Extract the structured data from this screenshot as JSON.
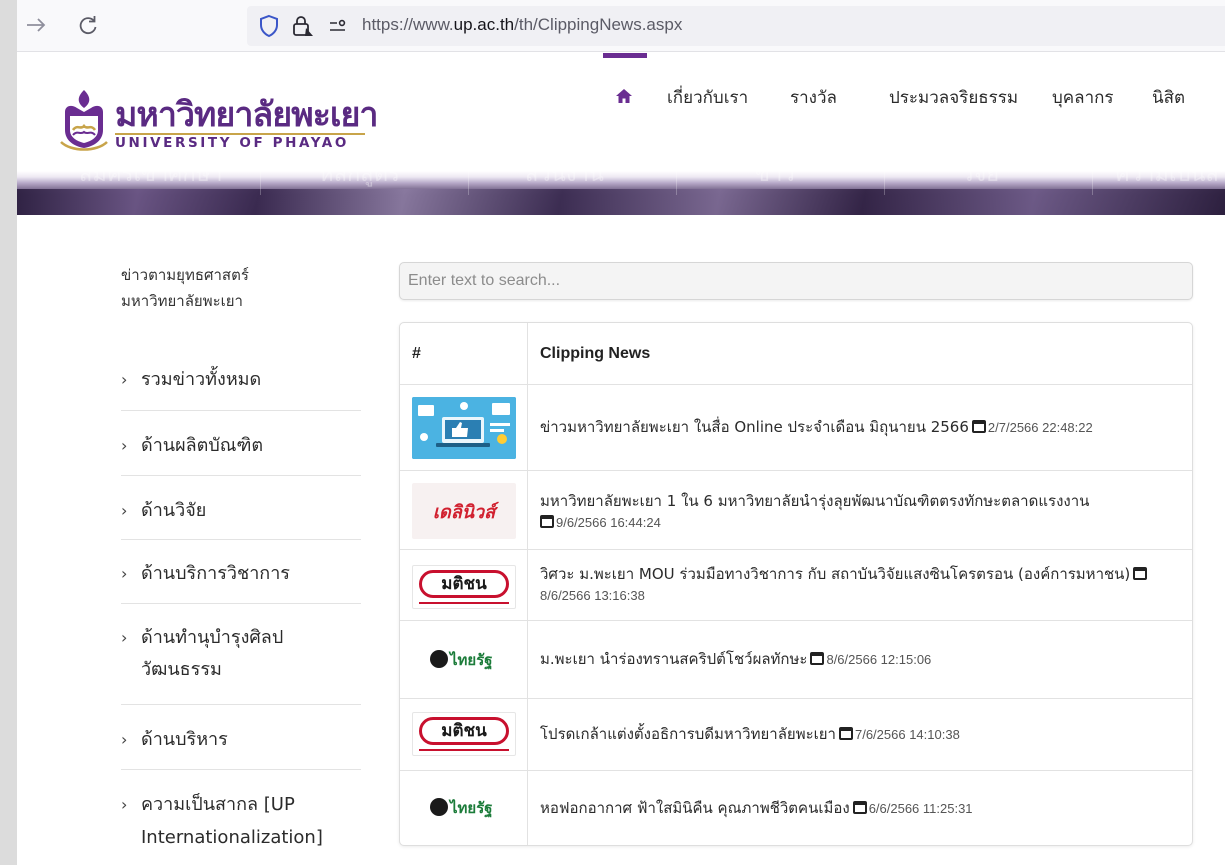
{
  "browser": {
    "url_prefix": "https://www.",
    "url_domain": "up.ac.th",
    "url_path": "/th/ClippingNews.aspx",
    "icons": [
      "forward-icon",
      "reload-icon",
      "shield-icon",
      "lock-icon",
      "permissions-icon"
    ]
  },
  "site": {
    "logo_th": "มหาวิทยาลัยพะเยา",
    "logo_en": "UNIVERSITY OF PHAYAO",
    "brand_color": "#5a2a82",
    "top_nav": [
      "เกี่ยวกับเรา",
      "รางวัล",
      "ประมวลจริยธรรม",
      "บุคลากร",
      "นิสิต"
    ],
    "main_menu": [
      "สมัครเข้าศึกษา",
      "หลักสูตร",
      "ส่วนงาน",
      "ข่าว",
      "วิจัย",
      "ความเป็นสากล"
    ]
  },
  "sidebar": {
    "title_line1": "ข่าวตามยุทธศาสตร์",
    "title_line2": "มหาวิทยาลัยพะเยา",
    "items": [
      {
        "label": "รวมข่าวทั้งหมด"
      },
      {
        "label": "ด้านผลิตบัณฑิต"
      },
      {
        "label": "ด้านวิจัย"
      },
      {
        "label": "ด้านบริการวิชาการ"
      },
      {
        "label": "ด้านทำนุบำรุงศิลป วัฒนธรรม"
      },
      {
        "label": "ด้านบริหาร"
      },
      {
        "label": "ความเป็นสากล [UP Internationalization]"
      }
    ]
  },
  "search": {
    "placeholder": "Enter text to search..."
  },
  "table": {
    "col_index": "#",
    "col_title": "Clipping News",
    "rows": [
      {
        "thumb": "online-media-illustration",
        "title": "ข่าวมหาวิทยาลัยพะเยา ในสื่อ Online ประจำเดือน มิถุนายน 2566",
        "date": "2/7/2566 22:48:22"
      },
      {
        "thumb": "dailynews-logo",
        "title": "มหาวิทยาลัยพะเยา 1 ใน 6 มหาวิทยาลัยนำรุ่งลุยพัฒนาบัณฑิตตรงทักษะตลาดแรงงาน",
        "date": "9/6/2566 16:44:24"
      },
      {
        "thumb": "matichon-logo",
        "title": "วิศวะ ม.พะเยา MOU ร่วมมือทางวิชาการ กับ สถาบันวิจัยแสงซินโครตรอน (องค์การมหาชน)",
        "date": "8/6/2566 13:16:38"
      },
      {
        "thumb": "thairath-logo",
        "title": "ม.พะเยา นำร่องทรานสคริปต์โชว์ผลทักษะ",
        "date": "8/6/2566 12:15:06"
      },
      {
        "thumb": "matichon-logo",
        "title": "โปรดเกล้าแต่งตั้งอธิการบดีมหาวิทยาลัยพะเยา",
        "date": "7/6/2566 14:10:38"
      },
      {
        "thumb": "thairath-logo",
        "title": "หอฟอกอากาศ ฟ้าใสมินิคืน คุณภาพชีวิตคนเมือง",
        "date": "6/6/2566 11:25:31"
      }
    ]
  },
  "thumb_text": {
    "dailynews": "เดลินิวส์",
    "matichon": "มติชน",
    "thairath": "ไทยรัฐ"
  }
}
